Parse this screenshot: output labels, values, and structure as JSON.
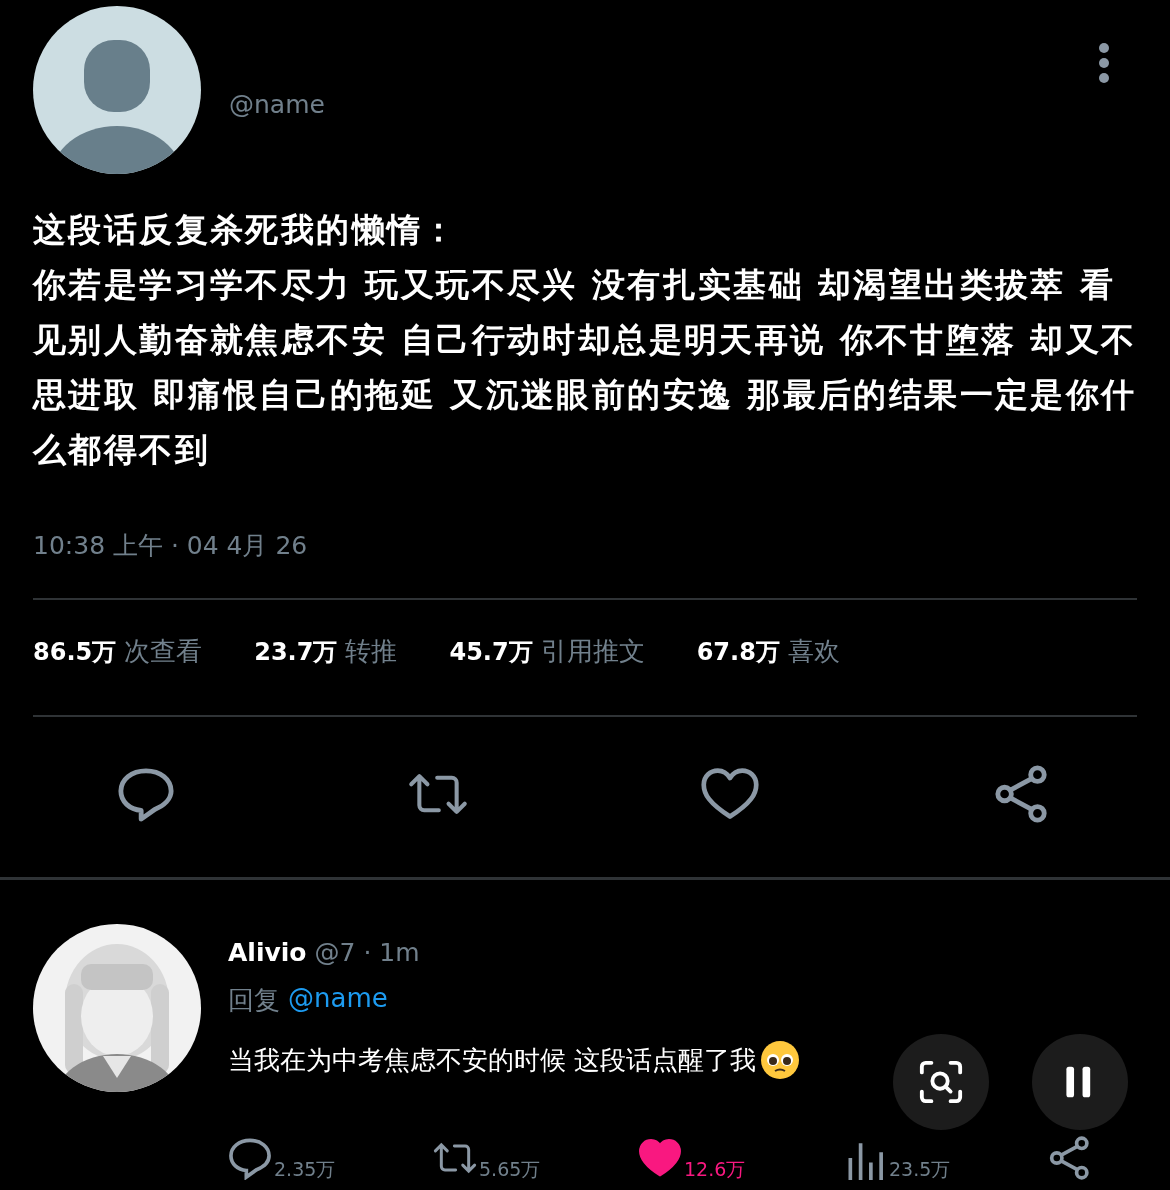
{
  "post": {
    "handle": "@name",
    "title": "这段话反复杀死我的懒惰：",
    "body": "你若是学习学不尽力 玩又玩不尽兴 没有扎实基础 却渴望出类拔萃 看见别人勤奋就焦虑不安 自己行动时却总是明天再说 你不甘堕落 却又不思进取 即痛恨自己的拖延 又沉迷眼前的安逸 那最后的结果一定是你什么都得不到",
    "time": "10:38 上午 · 04 4月 26",
    "stats": [
      {
        "value": "86.5万",
        "label": "次查看"
      },
      {
        "value": "23.7万",
        "label": "转推"
      },
      {
        "value": "45.7万",
        "label": "引用推文"
      },
      {
        "value": "67.8万",
        "label": "喜欢"
      }
    ],
    "actions": [
      {
        "kind": "reply"
      },
      {
        "kind": "retweet"
      },
      {
        "kind": "like",
        "selected": false
      },
      {
        "kind": "share"
      }
    ]
  },
  "reply": {
    "name": "Alivio",
    "meta": "@7 · 1m",
    "reply_to_label": "回复",
    "reply_to": "@name",
    "text": "当我在为中考焦虑不安的时候 这段话点醒了我",
    "actions": [
      {
        "kind": "reply",
        "count": "2.35万"
      },
      {
        "kind": "retweet",
        "count": "5.65万"
      },
      {
        "kind": "like",
        "count": "12.6万",
        "selected": true
      },
      {
        "kind": "views",
        "count": "23.5万"
      },
      {
        "kind": "share"
      }
    ]
  }
}
